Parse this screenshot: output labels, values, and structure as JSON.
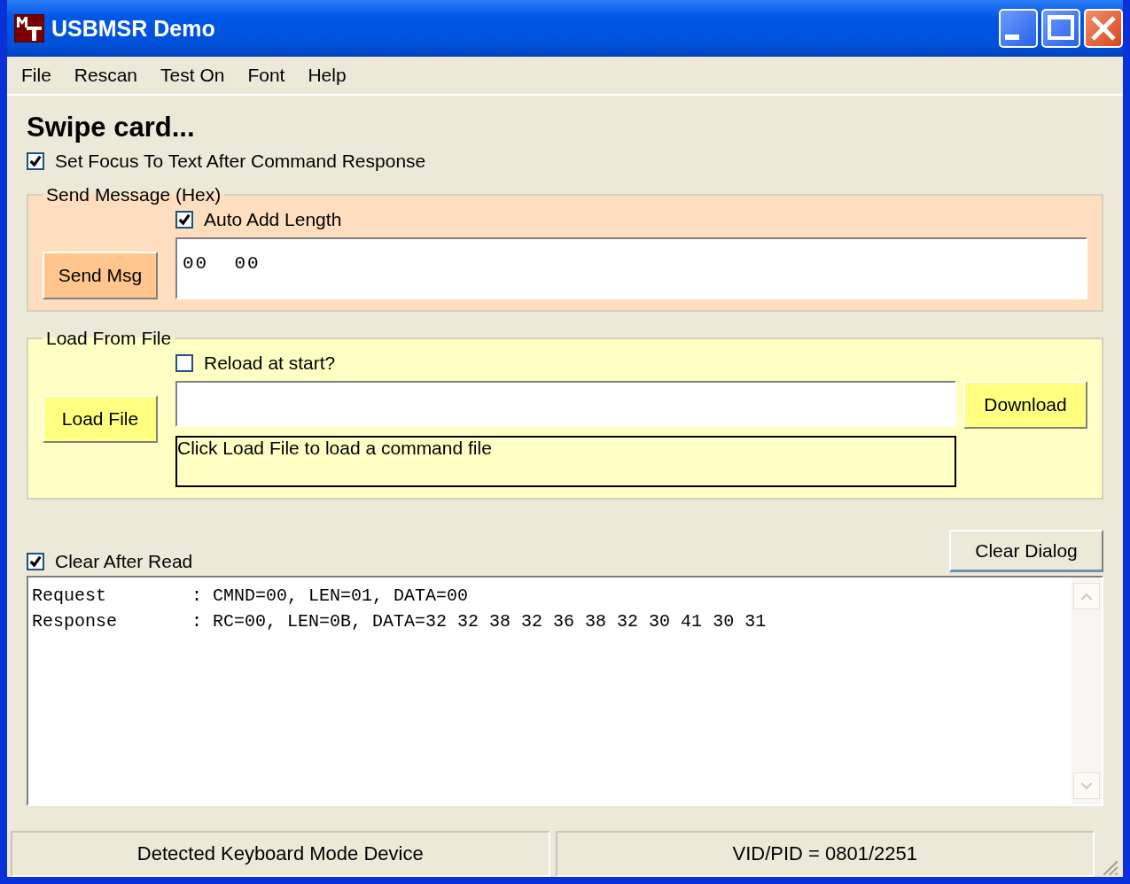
{
  "window": {
    "title": "USBMSR Demo"
  },
  "menu": [
    "File",
    "Rescan",
    "Test On",
    "Font",
    "Help"
  ],
  "heading": "Swipe card...",
  "focus_option": {
    "label": "Set Focus To Text After Command Response",
    "checked": true
  },
  "send_group": {
    "title": "Send Message (Hex)",
    "auto_length": {
      "label": "Auto Add Length",
      "checked": true
    },
    "button": "Send Msg",
    "message": "00  00"
  },
  "load_group": {
    "title": "Load From File",
    "reload": {
      "label": "Reload at start?",
      "checked": false
    },
    "button": "Load File",
    "download": "Download",
    "hint": "Click Load File to load a command file"
  },
  "clear_option": {
    "label": "Clear After Read",
    "checked": true
  },
  "clear_button": "Clear Dialog",
  "log": [
    "Request        : CMND=00, LEN=01, DATA=00",
    "Response       : RC=00, LEN=0B, DATA=32 32 38 32 36 38 32 30 41 30 31"
  ],
  "status_bar": [
    "Detected Keyboard Mode Device",
    "VID/PID = 0801/2251"
  ]
}
